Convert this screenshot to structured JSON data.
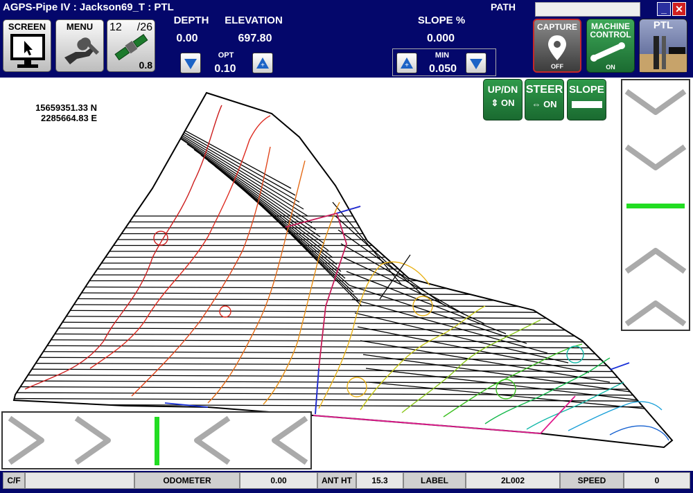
{
  "app": {
    "title": "AGPS-Pipe IV : Jackson69_T : PTL"
  },
  "path": {
    "label": "PATH",
    "value": ""
  },
  "window": {
    "minimize": "_",
    "close": "✕"
  },
  "toolbar": {
    "screen_label": "SCREEN",
    "menu_label": "MENU",
    "satellites_used": "12",
    "satellites_total": "/26",
    "gps_value": "0.8"
  },
  "readouts": {
    "depth_label": "DEPTH",
    "depth_value": "0.00",
    "elevation_label": "ELEVATION",
    "elevation_value": "697.80",
    "opt_label": "OPT",
    "opt_value": "0.10",
    "slope_label": "SLOPE %",
    "slope_value": "0.000",
    "min_label": "MIN",
    "min_value": "0.050"
  },
  "right_buttons": {
    "capture_label": "CAPTURE",
    "capture_state": "OFF",
    "machine_label": "MACHINE CONTROL",
    "machine_state": "ON",
    "ptl_label": "PTL"
  },
  "toggles": {
    "updn_label": "UP/DN",
    "updn_state": "ON",
    "steer_label": "STEER",
    "steer_state": "ON",
    "slope_label": "SLOPE"
  },
  "coordinates": {
    "northing": "15659351.33 N",
    "easting": "2285664.83 E"
  },
  "status": {
    "cf_label": "C/F",
    "cf_value": "",
    "odometer_label": "ODOMETER",
    "odometer_value": "0.00",
    "ant_label": "ANT HT",
    "ant_value": "15.3",
    "label_label": "LABEL",
    "label_value": "2L002",
    "speed_label": "SPEED",
    "speed_value": "0"
  },
  "colors": {
    "header_bg": "#04076b",
    "indicator_green": "#22dd22",
    "toggle_green": "#1f8a3e"
  },
  "icons": {
    "screen": "monitor-cursor-icon",
    "menu": "wrench-hand-icon",
    "gps": "satellite-icon",
    "capture": "map-pin-icon",
    "machine": "excavator-arm-icon",
    "ptl": "trench-icon"
  }
}
